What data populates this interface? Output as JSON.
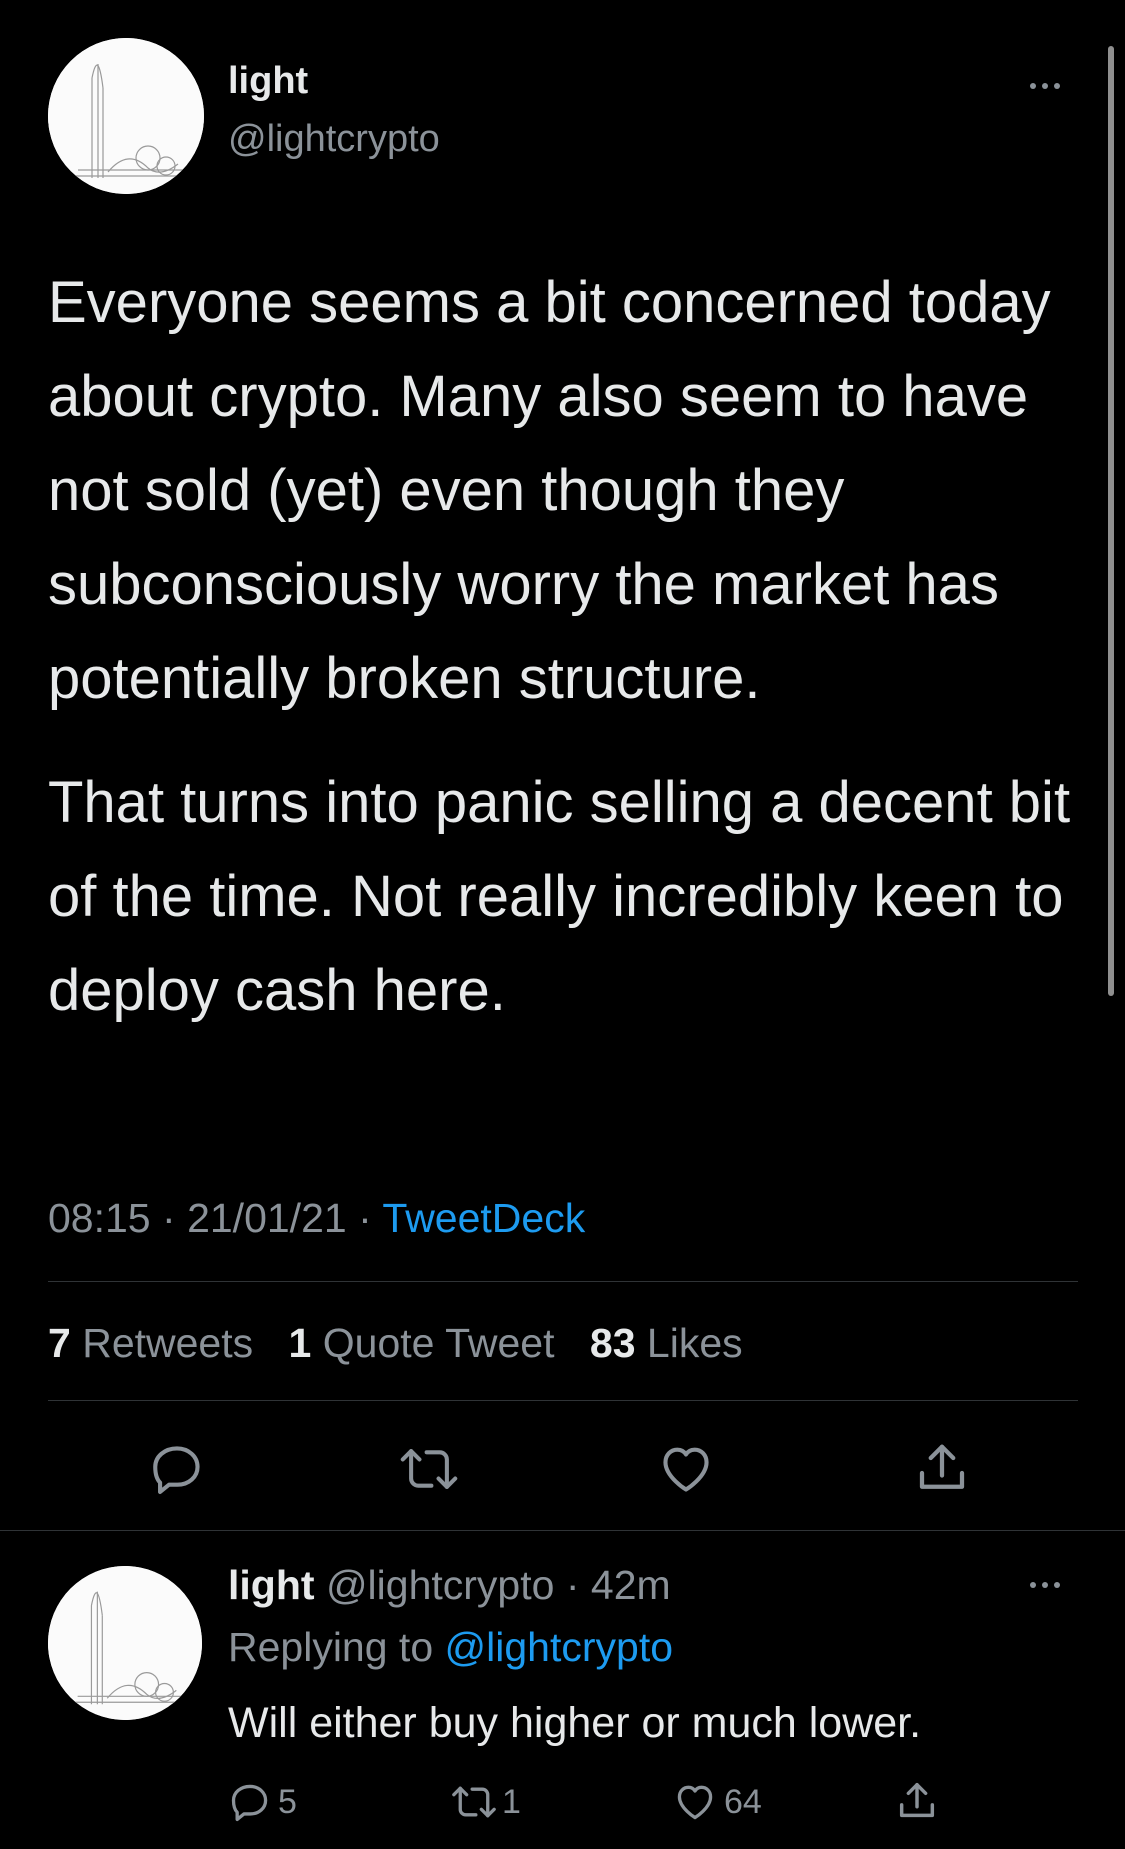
{
  "main_tweet": {
    "display_name": "light",
    "handle": "@lightcrypto",
    "paragraphs": [
      "Everyone seems a bit concerned today about crypto. Many also seem to have not sold (yet) even though they subconsciously worry the market has potentially broken structure.",
      "That turns into panic selling a decent bit of the time. Not really incredibly keen to deploy cash here."
    ],
    "time": "08:15",
    "date": "21/01/21",
    "sep": "·",
    "source": "TweetDeck",
    "stats": {
      "retweets_count": "7",
      "retweets_label": "Retweets",
      "quotes_count": "1",
      "quotes_label": "Quote Tweet",
      "likes_count": "83",
      "likes_label": "Likes"
    },
    "actions": [
      "reply-icon",
      "retweet-icon",
      "like-icon",
      "share-icon"
    ]
  },
  "reply": {
    "display_name": "light",
    "handle": "@lightcrypto",
    "sep": "·",
    "age": "42m",
    "replying_prefix": "Replying to",
    "replying_handle": "@lightcrypto",
    "text": "Will either buy higher or much lower.",
    "reply_count": "5",
    "retweet_count": "1",
    "like_count": "64"
  },
  "colors": {
    "background": "#000000",
    "text": "#e7e9ea",
    "muted": "#8b9299",
    "accent": "#1d9bf0",
    "divider": "#2f3336"
  }
}
